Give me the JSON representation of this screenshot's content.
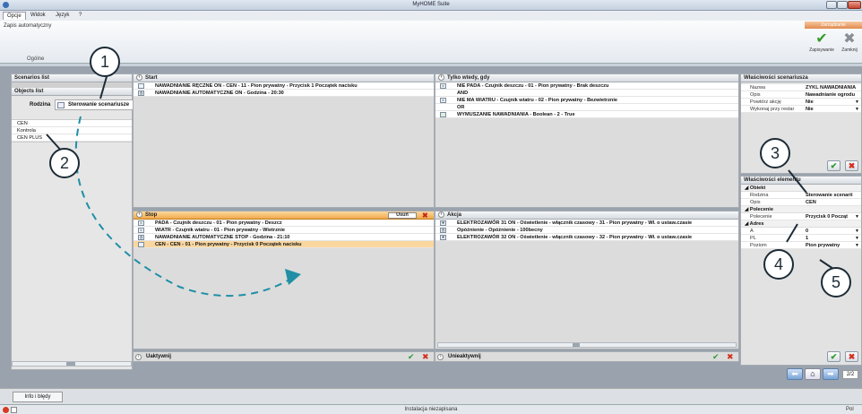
{
  "window": {
    "title": "MyHOME Suite"
  },
  "menu": {
    "items": [
      "Opcje",
      "Widok",
      "Język",
      "?"
    ]
  },
  "ribbon": {
    "autosave_label": "Zapis automatyczny",
    "group_label": "Ogólne",
    "brand_label": "Zarządzanie",
    "save_label": "Zapisywanie",
    "close_label": "Zamknij"
  },
  "left": {
    "scenarios_header": "Scenarios list",
    "objects_header": "Objects list",
    "family_label": "Rodzina",
    "family_value": "Sterowanie scenariusze",
    "items": [
      "CEN",
      "Kontrola",
      "CEN PLUS"
    ]
  },
  "start": {
    "header": "Start",
    "rows": [
      "NAWADNIANIE RĘCZNE ON - CEN - 11 - Pion prywatny - Przycisk 1 Początek nacisku",
      "NAWADNIANIE AUTOMATYCZNE ON - Godzina - 20:30"
    ]
  },
  "only_when": {
    "header": "Tylko wtedy, gdy",
    "rows": [
      "NIE PADA - Czujnik deszczu - 01 - Pion prywatny - Brak deszczu",
      "AND",
      "NIE MA WIATRU - Czujnik wiatru - 02 - Pion prywatny - Bezwietrznie",
      "OR",
      "WYMUSZANIE NAWADNIANIA - Boolean - 2 - True"
    ]
  },
  "stop": {
    "header": "Stop",
    "delete_label": "Usuń",
    "rows": [
      "PADA - Czujnik deszczu - 01 - Pion prywatny - Deszcz",
      "WIATR - Czujnik wiatru - 01 - Pion prywatny - Wietrznie",
      "NAWADNIANIE AUTOMATYCZNE STOP - Godzina - 21:10",
      "CEN - CEN - 01 - Pion prywatny - Przycisk 0 Początek nacisku"
    ]
  },
  "action": {
    "header": "Akcja",
    "rows": [
      "ELEKTROZAWÓR 31 ON - Oświetlenie - włącznik czasowy - 31 - Pion prywatny - Wł. o ustaw.czasie",
      "Opóźnienie - Opóźnienie - 100becny",
      "ELEKTROZAWÓR 32 ON - Oświetlenie - włącznik czasowy - 32 - Pion prywatny - Wł. o ustaw.czasie"
    ]
  },
  "bottom": {
    "activate_label": "Uaktywnij",
    "deactivate_label": "Unieaktywnij"
  },
  "scenario_props": {
    "header": "Właściwości scenariusza",
    "rows": [
      {
        "key": "Nazwa",
        "value": "ZYKL NAWADNIANIA"
      },
      {
        "key": "Opis",
        "value": "Nawadnianie ogrodu"
      },
      {
        "key": "Powtórz akcję",
        "value": "Nie"
      },
      {
        "key": "Wykonaj przy restar",
        "value": "Nie"
      }
    ]
  },
  "element_props": {
    "header": "Właściwości elementu",
    "object_section": "Obiekt",
    "object_rows": [
      {
        "key": "Rodzina",
        "value": "Sterowanie scenarii"
      },
      {
        "key": "Opis",
        "value": "CEN"
      }
    ],
    "command_section": "Polecenie",
    "command_rows": [
      {
        "key": "Polecenie",
        "value": "Przycisk 0 Począt"
      }
    ],
    "address_section": "Adres",
    "address_rows": [
      {
        "key": "A",
        "value": "0"
      },
      {
        "key": "PL",
        "value": "1"
      },
      {
        "key": "Poziom",
        "value": "Pion prywatny"
      }
    ]
  },
  "nav": {
    "page": "2/2"
  },
  "tabs": {
    "info_label": "Info i błędy"
  },
  "status": {
    "center": "Instalacja niezapisana",
    "right": "Pol"
  },
  "callouts": [
    "1",
    "2",
    "3",
    "4",
    "5"
  ]
}
